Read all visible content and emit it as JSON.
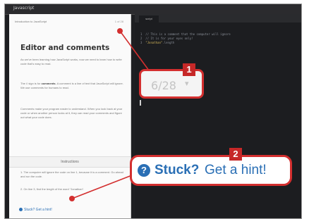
{
  "app": {
    "logo_text": "Javascript"
  },
  "lesson": {
    "crumb": "Introduction to JavaScript",
    "crumb_right": "1 of 28",
    "title": "Editor and comments",
    "para1": "As we've been learning how JavaScript works, now we need to learn how to write code that's easy to read.",
    "para2_pre": "The // sign is for ",
    "para2_bold": "comments",
    "para2_post": ". A comment is a line of text that JavaScript will ignore. We use comments for humans to read.",
    "para3": "Comments make your program easier to understand. When you look back at your code or when another person looks at it, they can read your comments and figure out what your code does.",
    "instructions_label": "Instructions",
    "step1": "1. The computer will ignore the code on line 1, because it is a comment. Go ahead and run the code.",
    "step2": "2. On line 3, find the length of the word \"Jonathan\"."
  },
  "editor": {
    "tab_label": "script",
    "code_line1": "1  // This is a comment that the computer will ignore",
    "code_line2": "2  // It is for your eyes only!",
    "code_line3_prefix": "3  ",
    "code_line3_string": "\"Jonathan\"",
    "code_line3_suffix": ".length"
  },
  "annotations": {
    "badge1": "1",
    "badge2": "2",
    "counter": "6/28",
    "counter_chevron": "▾",
    "hint_icon": "?",
    "stuck": "Stuck?",
    "get_hint": "Get a hint!",
    "small_hint_link": "Stuck? Get a hint!"
  },
  "colors": {
    "accent_red": "#d32f2f",
    "link_blue": "#2a6fb5",
    "editor_bg": "#1c1d20"
  }
}
